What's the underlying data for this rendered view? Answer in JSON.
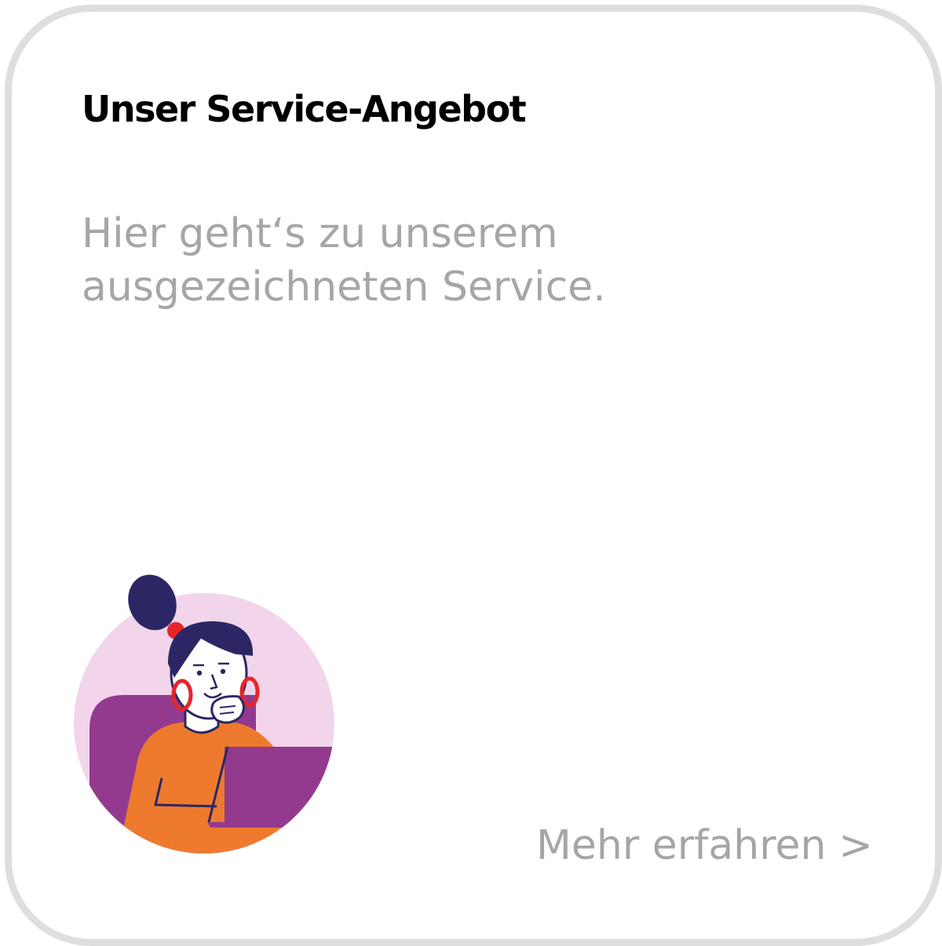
{
  "card": {
    "title": "Unser Service-Angebot",
    "description": "Hier geht‘s zu unserem ausgezeichneten Service.",
    "link_label": "Mehr erfahren",
    "link_chevron": ">"
  },
  "colors": {
    "border": "#dedede",
    "muted_text": "#a6a6a6",
    "circle_bg": "#f2d5ea",
    "purple": "#933a8f",
    "orange": "#ee7a2e",
    "hair": "#2c2764",
    "earring": "#e5262b"
  },
  "illustration": "woman-with-laptop-illustration"
}
